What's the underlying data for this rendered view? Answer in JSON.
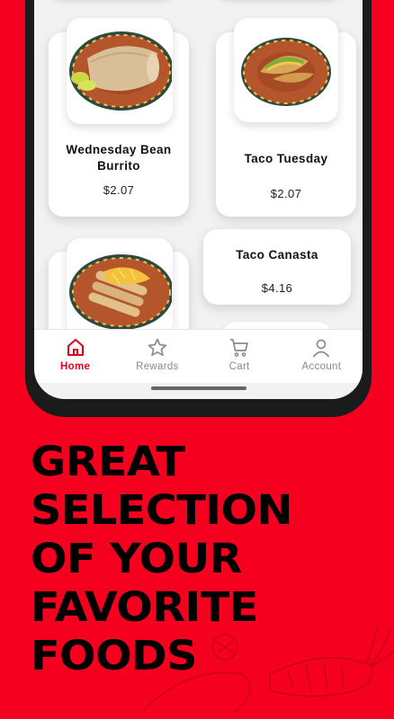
{
  "menu": {
    "items": [
      {
        "name": "Wednesday Bean Burrito",
        "price": "$2.07",
        "image": "burrito-plate"
      },
      {
        "name": "Taco Tuesday",
        "price": "$2.07",
        "image": "taco-plate"
      },
      {
        "name": "",
        "price": "",
        "image": "taquitos-plate"
      },
      {
        "name": "Taco Canasta",
        "price": "$4.16",
        "image": ""
      }
    ]
  },
  "nav": {
    "items": [
      {
        "label": "Home",
        "icon": "home-icon",
        "active": true
      },
      {
        "label": "Rewards",
        "icon": "star-icon",
        "active": false
      },
      {
        "label": "Cart",
        "icon": "cart-icon",
        "active": false
      },
      {
        "label": "Account",
        "icon": "account-icon",
        "active": false
      }
    ]
  },
  "headline": {
    "lines": [
      "GREAT",
      "SELECTION",
      "OF YOUR",
      "FAVORITE",
      "FOODS"
    ]
  },
  "colors": {
    "background": "#F5001E",
    "accent": "#E4001C",
    "headline": "#000000"
  }
}
